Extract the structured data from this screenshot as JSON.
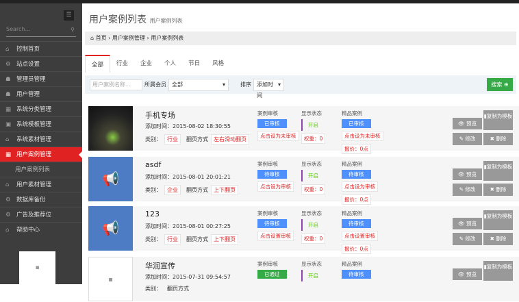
{
  "sidebar": {
    "search_placeholder": "Search...",
    "items": [
      {
        "label": "控制首页",
        "icon": "⌂"
      },
      {
        "label": "站点设置",
        "icon": "⚙"
      },
      {
        "label": "管理员管理",
        "icon": "☗"
      },
      {
        "label": "用户管理",
        "icon": "☗"
      },
      {
        "label": "系统分类管理",
        "icon": "▦"
      },
      {
        "label": "系统模板管理",
        "icon": "▣"
      },
      {
        "label": "系统素材管理",
        "icon": "⌂"
      },
      {
        "label": "用户案例管理",
        "icon": "▦"
      },
      {
        "label": "用户案例列表",
        "icon": ""
      },
      {
        "label": "用户素材管理",
        "icon": "⌂"
      },
      {
        "label": "数据库备份",
        "icon": "⚙"
      },
      {
        "label": "广告及推荐位",
        "icon": "⚙"
      },
      {
        "label": "帮助中心",
        "icon": "⌂"
      }
    ]
  },
  "header": {
    "title": "用户案例列表",
    "subtitle": "用户案例列表"
  },
  "breadcrumb": [
    "首页",
    "用户案例管理",
    "用户案例列表"
  ],
  "tabs": [
    "全部",
    "行业",
    "企业",
    "个人",
    "节日",
    "风格"
  ],
  "filter": {
    "name_placeholder": "用户案例名称...",
    "member_label": "所属会员",
    "member_value": "全部",
    "sort_label": "排序",
    "sort_value": "添加时间",
    "search_label": "搜索"
  },
  "labels": {
    "audit": "案例审核",
    "display": "显示状态",
    "featured": "精品案例",
    "category": "类别：",
    "flip": "翻页方式",
    "preview": "预览",
    "copy": "复制为模板",
    "edit": "修改",
    "delete": "删除"
  },
  "rows": [
    {
      "name": "手机专场",
      "time": "添加时间：2015-08-02 18:30:55",
      "category": "行业",
      "flip": "左右滑动翻页",
      "audit": "已审核",
      "audit_action": "点击设为未审核",
      "display": "开启",
      "weight": "权重：0",
      "featured": "已审核",
      "featured_action": "点击设为未审核",
      "price": "报价：0点"
    },
    {
      "name": "asdf",
      "time": "添加时间：2015-08-01 20:01:21",
      "category": "企业",
      "flip": "上下翻页",
      "audit": "待审核",
      "audit_action": "点击设为审核",
      "display": "开启",
      "weight": "权重：0",
      "featured": "待审核",
      "featured_action": "点击设为审核",
      "price": "报价：0点"
    },
    {
      "name": "123",
      "time": "添加时间：2015-08-01 00:27:25",
      "category": "行业",
      "flip": "上下翻页",
      "audit": "待审核",
      "audit_action": "点击设置审核",
      "display": "开启",
      "weight": "权重：0",
      "featured": "待审核",
      "featured_action": "点击设置审核",
      "price": "报价：0点"
    },
    {
      "name": "华润宣传",
      "time": "添加时间：2015-07-31 09:54:57",
      "category": "",
      "flip": "",
      "audit": "已通过",
      "audit_action": "",
      "display": "开启",
      "weight": "",
      "featured": "待审核",
      "featured_action": "",
      "price": ""
    }
  ]
}
